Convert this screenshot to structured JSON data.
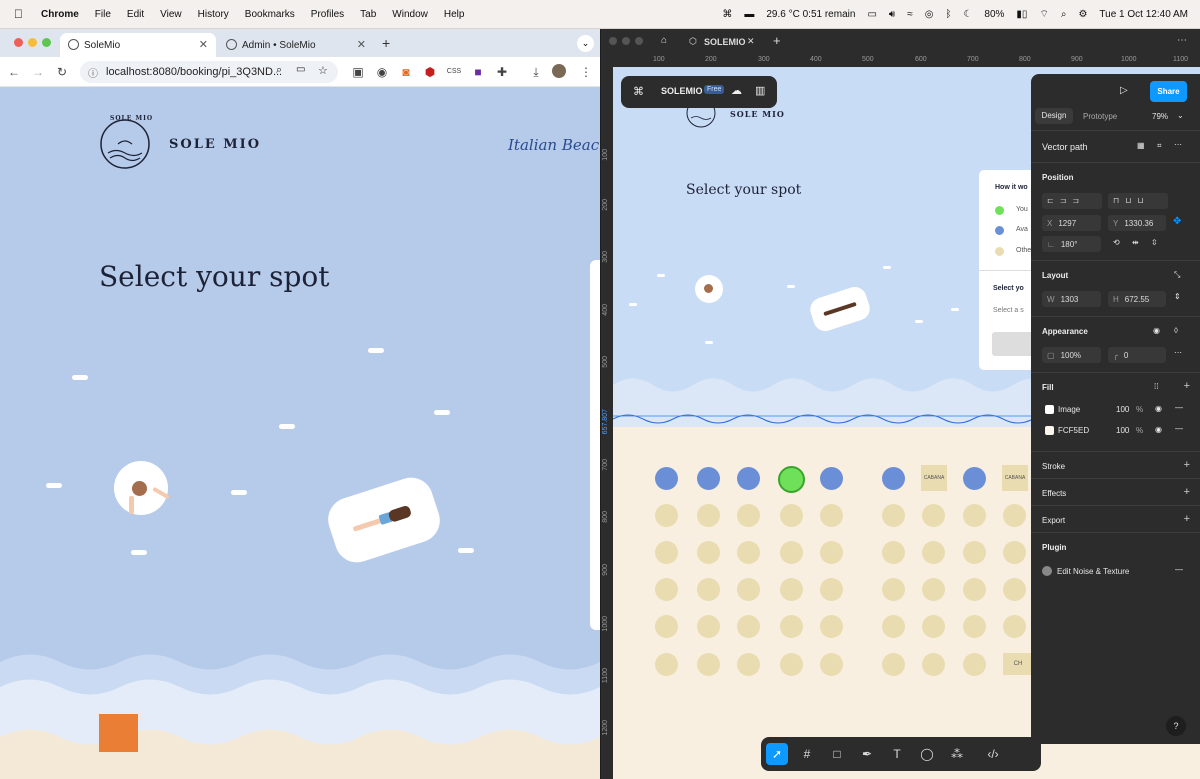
{
  "menubar": {
    "apple": "",
    "app": "Chrome",
    "items": [
      "File",
      "Edit",
      "View",
      "History",
      "Bookmarks",
      "Profiles",
      "Tab",
      "Window",
      "Help"
    ],
    "weather": "29.6 °C 0:51 remain",
    "battery": "80%",
    "datetime": "Tue 1 Oct  12:40 AM"
  },
  "chrome": {
    "tabs": [
      {
        "label": "SoleMio"
      },
      {
        "label": "Admin • SoleMio"
      }
    ],
    "url": "localhost:8080/booking/pi_3Q3ND..."
  },
  "site": {
    "logo_text": "SOLE MIO",
    "logo_ring_text": "SOLE MIO",
    "brand": "SOLE MIO",
    "tagline": "Italian Beach",
    "heading": "Select your spot"
  },
  "figma": {
    "file_name": "SOLEMIO",
    "plan": "Free",
    "share": "Share",
    "tabs": {
      "design": "Design",
      "prototype": "Prototype",
      "zoom": "79%"
    },
    "ruler_top": [
      "100",
      "200",
      "300",
      "400",
      "500",
      "600",
      "700",
      "800",
      "900",
      "1000",
      "1100"
    ],
    "ruler_left": [
      "100",
      "200",
      "300",
      "400",
      "500",
      "657.807",
      "700",
      "800",
      "900",
      "1000",
      "1100",
      "1200"
    ],
    "canvas": {
      "brand": "SOLE MIO",
      "heading": "Select your spot",
      "legend_title": "How it wo",
      "legend": [
        "You",
        "Ava",
        "Othe"
      ],
      "select_title": "Select yo",
      "select_sub": "Select a s",
      "cabana": "CABANA",
      "ch": "CH"
    },
    "panel": {
      "layer_name": "Vector path",
      "position": "Position",
      "x": "1297",
      "y": "1330.36",
      "rotation": "180°",
      "layout": "Layout",
      "w": "1303",
      "h": "672.55",
      "appearance": "Appearance",
      "opacity": "100%",
      "radius": "0",
      "fill": "Fill",
      "fills": [
        {
          "name": "Image",
          "opacity": "100",
          "unit": "%"
        },
        {
          "name": "FCF5ED",
          "opacity": "100",
          "unit": "%"
        }
      ],
      "stroke": "Stroke",
      "effects": "Effects",
      "export": "Export",
      "plugin": "Plugin",
      "plugin_name": "Edit Noise & Texture",
      "help": "?"
    }
  },
  "colors": {
    "accent": "#2f80ed",
    "available": "#6b8fd6",
    "selected": "#6ee05a",
    "other": "#e8dcb0",
    "sky": "#b6cbe9",
    "cta": "#e97e34"
  }
}
